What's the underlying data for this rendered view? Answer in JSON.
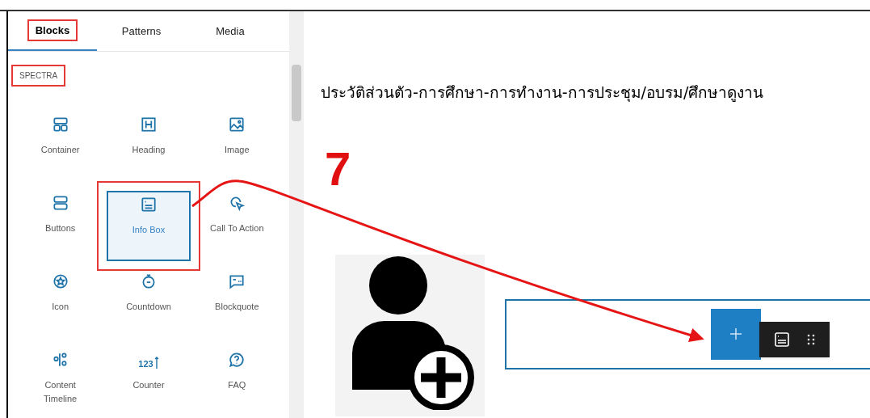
{
  "tabs": [
    {
      "label": "Blocks",
      "selected": true,
      "highlighted": true
    },
    {
      "label": "Patterns",
      "selected": false,
      "highlighted": false
    },
    {
      "label": "Media",
      "selected": false,
      "highlighted": false
    }
  ],
  "category": {
    "label": "SPECTRA",
    "highlighted": true
  },
  "blocks": [
    {
      "label": "Container",
      "selected": false,
      "highlighted": false
    },
    {
      "label": "Heading",
      "selected": false,
      "highlighted": false
    },
    {
      "label": "Image",
      "selected": false,
      "highlighted": false
    },
    {
      "label": "Buttons",
      "selected": false,
      "highlighted": false
    },
    {
      "label": "Info Box",
      "selected": true,
      "highlighted": true
    },
    {
      "label": "Call To Action",
      "selected": false,
      "highlighted": false
    },
    {
      "label": "Icon",
      "selected": false,
      "highlighted": false
    },
    {
      "label": "Countdown",
      "selected": false,
      "highlighted": false
    },
    {
      "label": "Blockquote",
      "selected": false,
      "highlighted": false
    },
    {
      "label": "Content Timeline",
      "selected": false,
      "highlighted": false
    },
    {
      "label": "Counter",
      "selected": false,
      "highlighted": false,
      "icon_text": "123"
    },
    {
      "label": "FAQ",
      "selected": false,
      "highlighted": false
    }
  ],
  "page_title": "ประวัติส่วนตัว-การศึกษา-การทำงาน-การประชุม/อบรม/ศึกษาดูงาน",
  "step_number": "7"
}
